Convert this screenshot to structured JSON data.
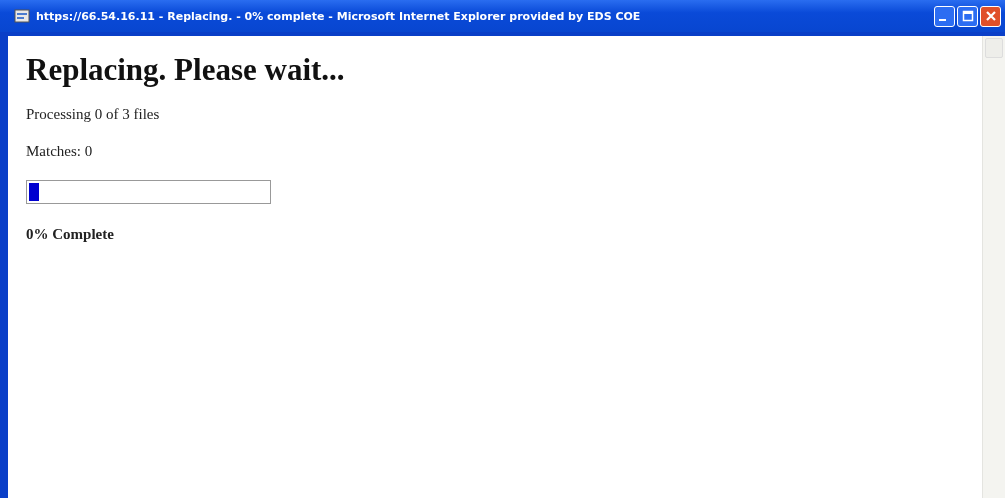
{
  "window": {
    "title": "https://66.54.16.11 - Replacing. - 0% complete - Microsoft Internet Explorer provided by EDS COE"
  },
  "page": {
    "heading": "Replacing. Please wait...",
    "processing": "Processing 0 of 3 files",
    "matches": "Matches: 0",
    "progress": {
      "level": 0.04
    },
    "status": "0% Complete"
  }
}
